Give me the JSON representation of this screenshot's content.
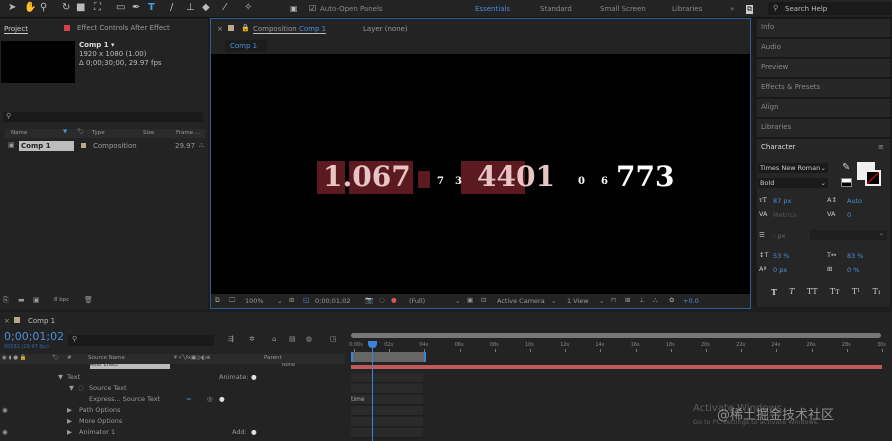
{
  "toolbar": {
    "auto_open_label": "Auto-Open Panels",
    "workspaces": [
      "Essentials",
      "Standard",
      "Small Screen",
      "Libraries"
    ],
    "search_placeholder": "Search Help"
  },
  "project": {
    "tab": "Project",
    "effect_tab": "Effect Controls After Effect",
    "comp_name": "Comp 1 ▾",
    "comp_res": "1920 x 1080 (1.00)",
    "comp_dur": "Δ 0;00;30;00, 29.97 fps",
    "columns": [
      "Name",
      "Type",
      "Size",
      "Frame ..."
    ],
    "item": {
      "name": "Comp 1",
      "type": "Composition",
      "fps": "29.97"
    },
    "bpc": "8 bpc"
  },
  "viewer": {
    "tab": "Composition",
    "tab_comp": "Comp 1",
    "layer_tab": "Layer (none)",
    "sub_tab": "Comp 1",
    "canvas_text": {
      "a": "1.067",
      "b": "7",
      "c": "3",
      "d": "4401",
      "e": "0",
      "f": "6",
      "g": "773"
    },
    "zoom": "100%",
    "timecode": "0;00;01;02",
    "resolution": "(Full)",
    "camera": "Active Camera",
    "view": "1 View",
    "exposure": "+0.0"
  },
  "right_panels": [
    "Info",
    "Audio",
    "Preview",
    "Effects & Presets",
    "Align",
    "Libraries"
  ],
  "character": {
    "title": "Character",
    "font": "Times New Roman",
    "style": "Bold",
    "size": "87 px",
    "leading": "Auto",
    "kerning": "Metrics",
    "tracking": "0",
    "stroke": "- px",
    "vscale": "53 %",
    "hscale": "83 %",
    "baseline": "0 px",
    "tsume": "0 %",
    "styles": [
      "T",
      "T",
      "TT",
      "Tт",
      "T¹",
      "T₁"
    ]
  },
  "timeline": {
    "tab": "Comp 1",
    "timecode": "0;00;01;02",
    "frames": "00032 (29.97 fps)",
    "headers": [
      "#",
      "Source Name",
      "Parent"
    ],
    "parent_value": "None",
    "layer_name": "After Effect",
    "rows": [
      {
        "label": "Text",
        "extra": "Animate:"
      },
      {
        "label": "Source Text",
        "extra": ""
      },
      {
        "label": "Express... Source Text",
        "extra": ""
      },
      {
        "label": "Path Options",
        "extra": ""
      },
      {
        "label": "More Options",
        "extra": ""
      },
      {
        "label": "Animator 1",
        "extra": "Add:"
      }
    ],
    "expression": "time",
    "ticks": [
      "0:00s",
      "02s",
      "04s",
      "06s",
      "08s",
      "10s",
      "12s",
      "14s",
      "16s",
      "18s",
      "20s",
      "22s",
      "24s",
      "26s",
      "28s",
      "30s"
    ]
  },
  "watermark": {
    "line1": "Activate Windows",
    "line2": "Go to PC settings to activate Windows.",
    "overlay": "@稀土掘金技术社区"
  }
}
